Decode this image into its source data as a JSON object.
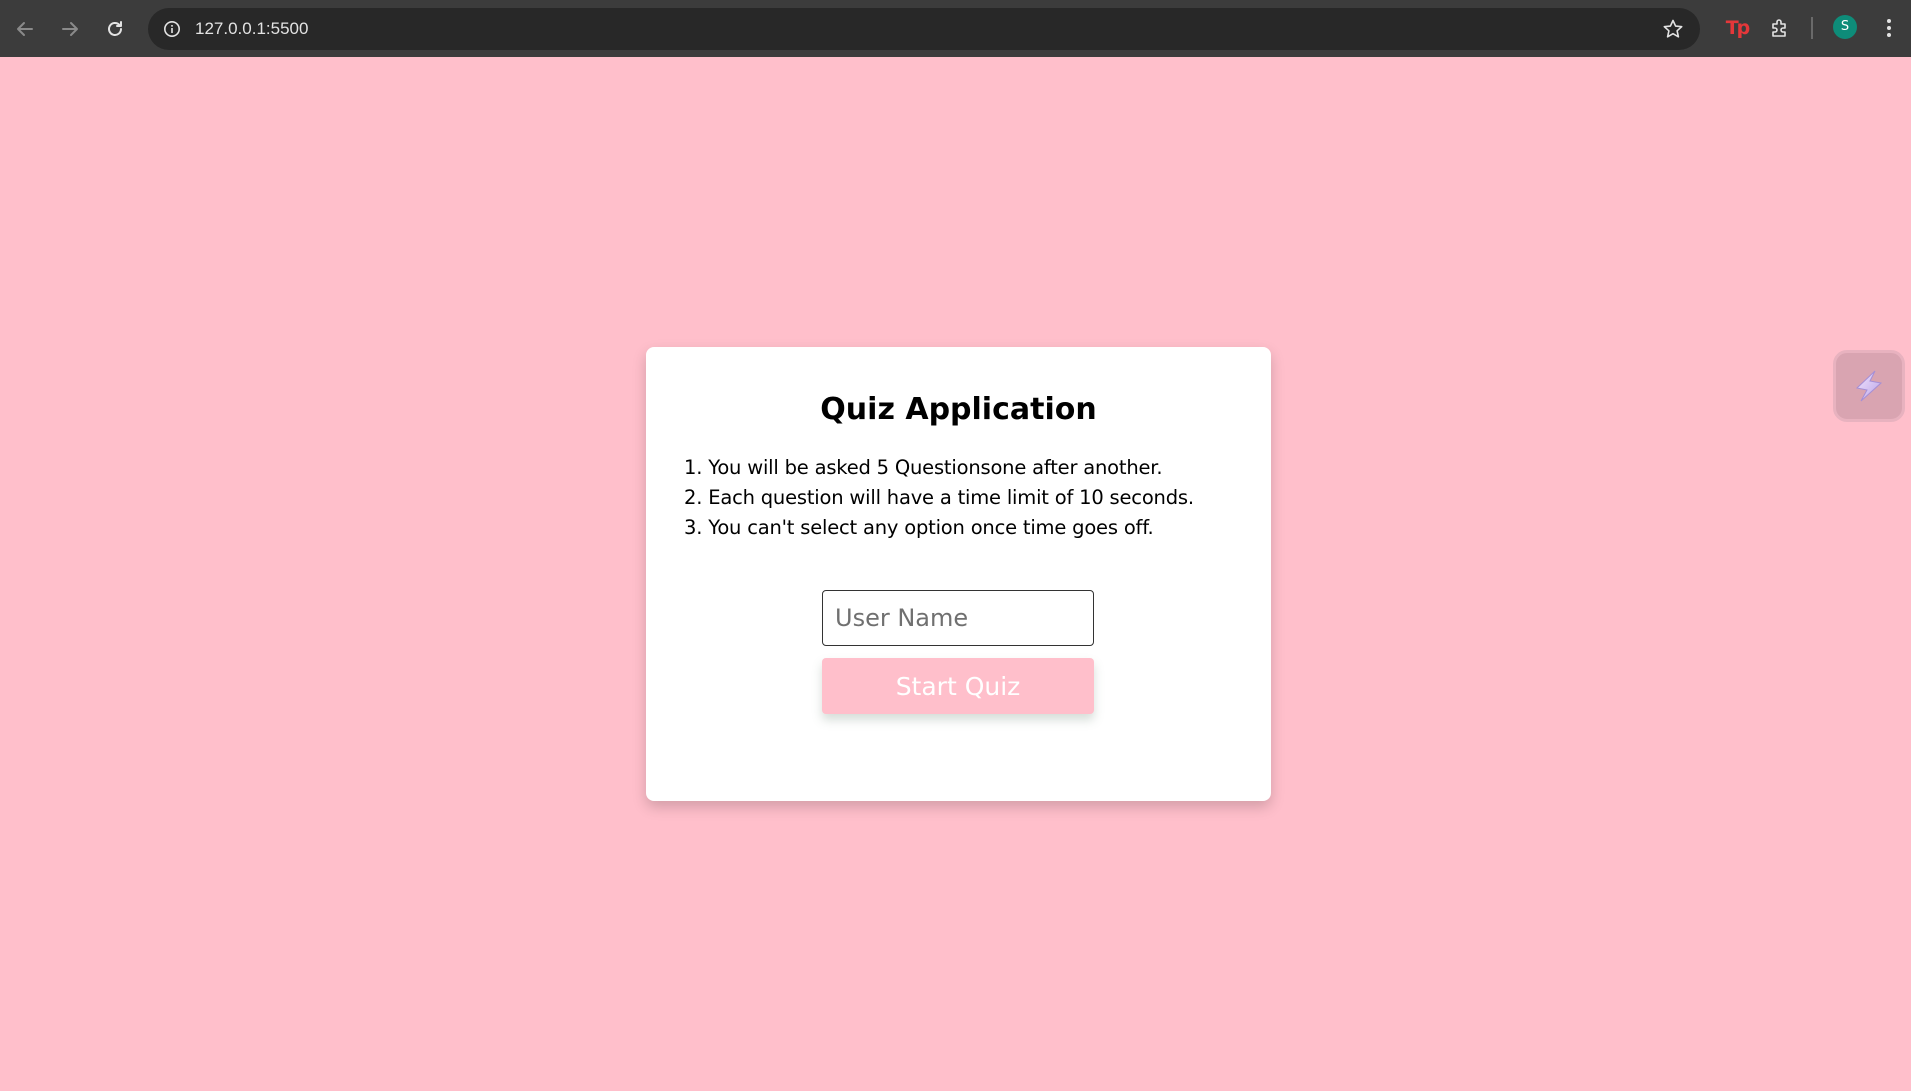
{
  "browser": {
    "url": "127.0.0.1:5500",
    "extension_label": "Tp",
    "profile_initial": "S",
    "icons": {
      "back": "arrow-left-icon",
      "forward": "arrow-right-icon",
      "reload": "reload-icon",
      "site_info": "info-icon",
      "bookmark": "star-icon",
      "extensions": "puzzle-icon",
      "menu": "kebab-menu-icon"
    }
  },
  "quiz": {
    "title": "Quiz Application",
    "rules": [
      "1. You will be asked 5 Questionsone after another.",
      "2. Each question will have a time limit of 10 seconds.",
      "3. You can't select any option once time goes off."
    ],
    "username_placeholder": "User Name",
    "username_value": "",
    "start_label": "Start Quiz"
  },
  "side_widget": {
    "icon": "lightning-icon"
  },
  "colors": {
    "page_background": "#ffbfcb",
    "card_background": "#ffffff",
    "button_background": "#ffbfcb",
    "toolbar": "#3c3c3c",
    "avatar": "#0e8c79",
    "extension_accent": "#e5373a"
  }
}
